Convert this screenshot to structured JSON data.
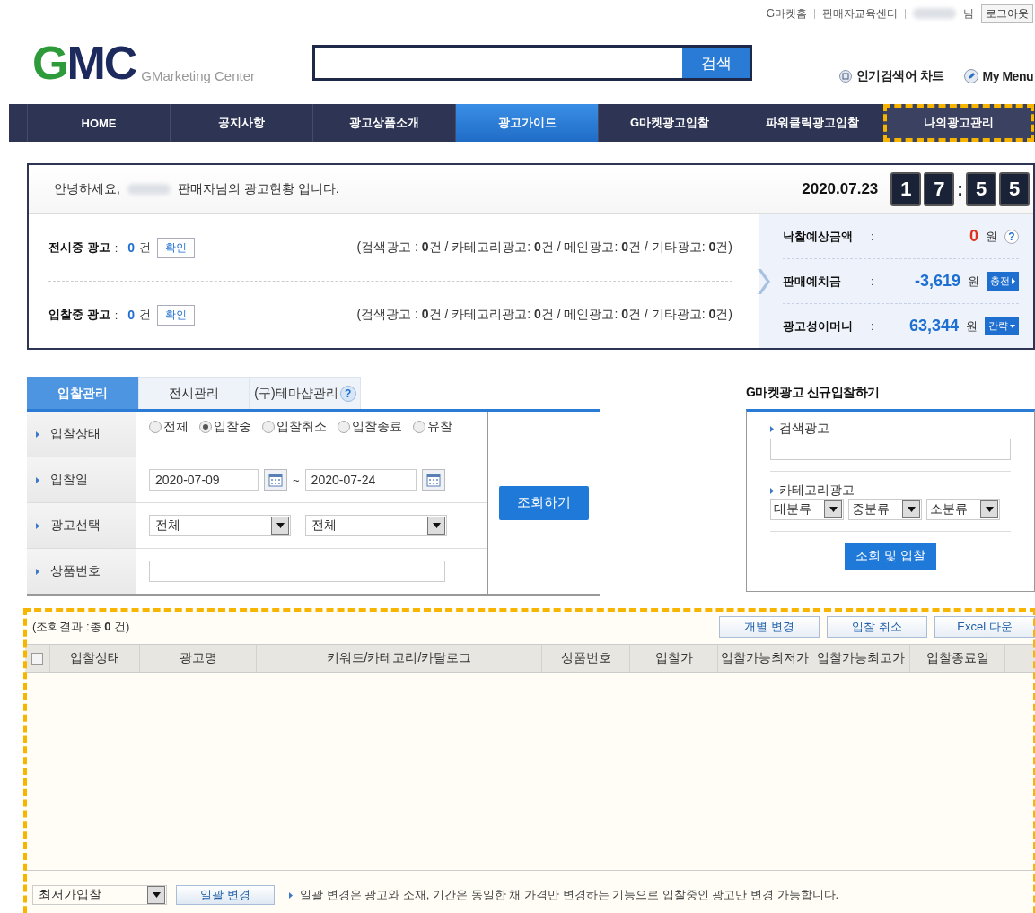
{
  "top_links": [
    {
      "label": "G마켓홈"
    },
    {
      "label": "판매자교육센터"
    }
  ],
  "user": {
    "suffix": "님",
    "logout": "로그아웃"
  },
  "header": {
    "logo": "GMC",
    "logo_subtitle": "GMarketing Center",
    "search_button": "검색",
    "links": [
      {
        "kind": "chart",
        "label": "인기검색어 차트"
      },
      {
        "kind": "menu",
        "label": "My Menu"
      }
    ]
  },
  "nav": [
    {
      "label": "HOME",
      "selected": false,
      "highlighted": false
    },
    {
      "label": "공지사항",
      "selected": false,
      "highlighted": false
    },
    {
      "label": "광고상품소개",
      "selected": false,
      "highlighted": false
    },
    {
      "label": "광고가이드",
      "selected": true,
      "highlighted": false
    },
    {
      "label": "G마켓광고입찰",
      "selected": false,
      "highlighted": false
    },
    {
      "label": "파워클릭광고입찰",
      "selected": false,
      "highlighted": false
    },
    {
      "label": "나의광고관리",
      "selected": false,
      "highlighted": true
    }
  ],
  "summary": {
    "greeting_before": "안녕하세요,",
    "greeting_after": "판매자님의 광고현황 입니다.",
    "date": "2020.07.23",
    "clock": [
      "1",
      "7",
      ":",
      "5",
      "5"
    ],
    "rows": [
      {
        "label": "전시중 광고",
        "colon": ":",
        "count": "0",
        "unit": "건",
        "button": "확인",
        "breakdown": "(검색광고 : **0**건 / 카테고리광고: **0**건 / 메인광고: **0**건 / 기타광고: **0**건)"
      },
      {
        "label": "입찰중 광고",
        "colon": ":",
        "count": "0",
        "unit": "건",
        "button": "확인",
        "breakdown": "(검색광고 : **0**건 / 카테고리광고: **0**건 / 메인광고: **0**건 / 기타광고: **0**건)"
      }
    ],
    "money": [
      {
        "label": "낙찰예상금액",
        "colon": ":",
        "amount": "0",
        "color": "#e0311c",
        "unit": "원",
        "button": "?",
        "kind": "help"
      },
      {
        "label": "판매예치금",
        "colon": ":",
        "amount": "-3,619",
        "color": "#1d6fd1",
        "unit": "원",
        "button": "충전",
        "kind": "next"
      },
      {
        "label": "광고성이머니",
        "colon": ":",
        "amount": "63,344",
        "color": "#1d6fd1",
        "unit": "원",
        "button": "간략",
        "kind": "dropdown"
      }
    ]
  },
  "tabs": [
    {
      "label": "입찰관리",
      "selected": true
    },
    {
      "label": "전시관리",
      "selected": false
    },
    {
      "label": "(구)테마샵관리",
      "selected": false,
      "help": "?"
    }
  ],
  "filters": [
    {
      "kind": "radio",
      "label": "입찰상태",
      "options": [
        {
          "label": "전체",
          "selected": false
        },
        {
          "label": "입찰중",
          "selected": true
        },
        {
          "label": "입찰취소",
          "selected": false
        },
        {
          "label": "입찰종료",
          "selected": false
        },
        {
          "label": "유찰",
          "selected": false
        }
      ]
    },
    {
      "kind": "date_range",
      "label": "입찰일",
      "from": "2020-07-09",
      "separator": "~",
      "to": "2020-07-24"
    },
    {
      "kind": "selects",
      "label": "광고선택",
      "values": [
        "전체",
        "전체"
      ]
    },
    {
      "kind": "text",
      "label": "상품번호"
    }
  ],
  "search_button": "조회하기",
  "new_bid": {
    "title": "G마켓광고 신규입찰하기",
    "search_label": "검색광고",
    "category_label": "카테고리광고",
    "categories": [
      "대분류",
      "중분류",
      "소분류"
    ],
    "button": "조회 및 입찰"
  },
  "results": {
    "highlighted": true,
    "select_all_checked": false,
    "count_text": "(조회결과 :총 **0** 건)",
    "buttons": [
      "개별 변경",
      "입찰 취소",
      "Excel 다운"
    ],
    "columns": [
      "입찰상태",
      "광고명",
      "키워드/카테고리/카탈로그",
      "상품번호",
      "입찰가",
      "입찰가능최저가",
      "입찰가능최고가",
      "입찰종료일"
    ],
    "footer_select": "최저가입찰",
    "footer_button": "일괄 변경",
    "note": "일괄 변경은 광고와 소재, 기간은 동일한 채 가격만 변경하는 기능으로 입찰중인 광고만 변경 가능합니다."
  }
}
